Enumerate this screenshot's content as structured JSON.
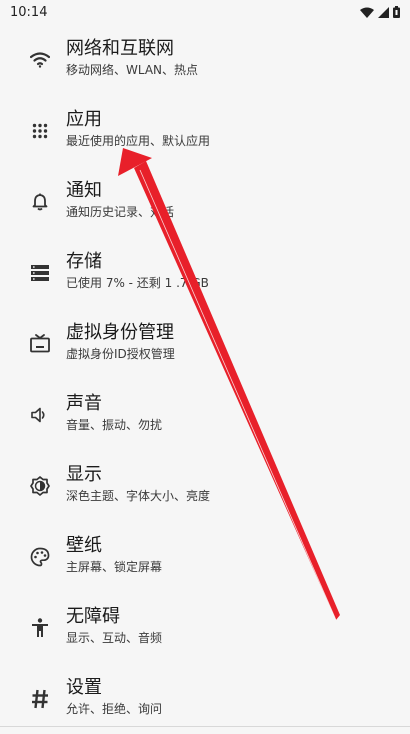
{
  "status_bar": {
    "time": "10:14",
    "icons": [
      "wifi-icon",
      "signal-icon",
      "battery-icon"
    ]
  },
  "settings": {
    "items": [
      {
        "icon": "wifi-icon",
        "title": "网络和互联网",
        "subtitle": "移动网络、WLAN、热点"
      },
      {
        "icon": "apps-icon",
        "title": "应用",
        "subtitle": "最近使用的应用、默认应用"
      },
      {
        "icon": "bell-icon",
        "title": "通知",
        "subtitle": "通知历史记录、对话"
      },
      {
        "icon": "storage-icon",
        "title": "存储",
        "subtitle": "已使用 7% - 还剩 1 .7 GB"
      },
      {
        "icon": "tv-icon",
        "title": "虚拟身份管理",
        "subtitle": "虚拟身份ID授权管理"
      },
      {
        "icon": "volume-icon",
        "title": "声音",
        "subtitle": "音量、振动、勿扰"
      },
      {
        "icon": "brightness-icon",
        "title": "显示",
        "subtitle": "深色主题、字体大小、亮度"
      },
      {
        "icon": "palette-icon",
        "title": "壁纸",
        "subtitle": "主屏幕、锁定屏幕"
      },
      {
        "icon": "accessibility-icon",
        "title": "无障碍",
        "subtitle": "显示、互动、音频"
      },
      {
        "icon": "hash-icon",
        "title": "设置",
        "subtitle": "允许、拒绝、询问"
      }
    ]
  },
  "annotation": {
    "arrow_icon": "red-arrow-icon",
    "color": "#e8202a"
  }
}
